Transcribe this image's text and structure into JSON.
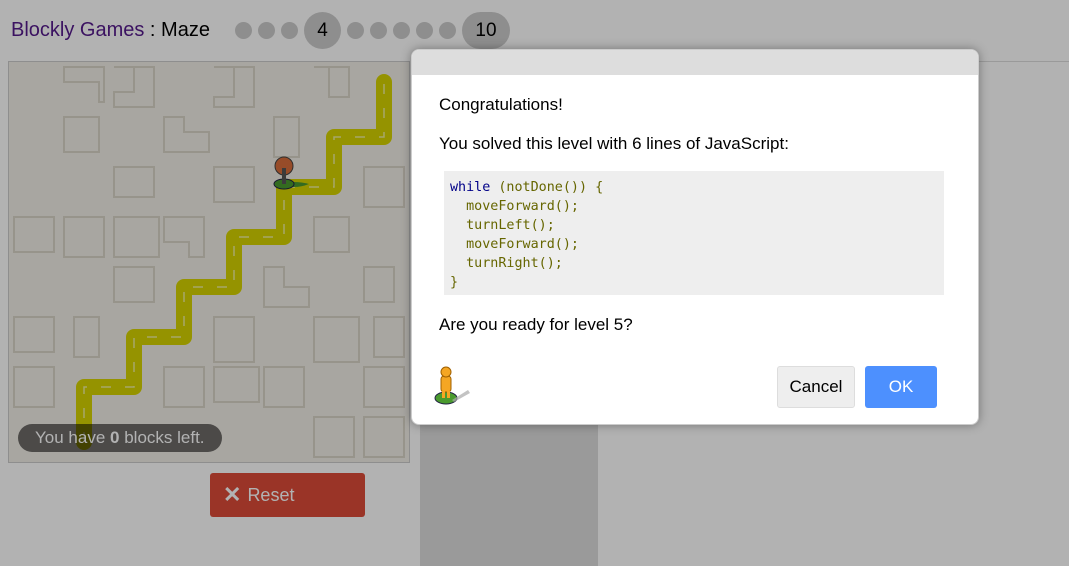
{
  "header": {
    "app_name": "Blockly Games",
    "separator": " : ",
    "game_name": "Maze",
    "current_level": "4",
    "last_level": "10"
  },
  "maze": {
    "capacity_prefix": "You have ",
    "capacity_count": "0",
    "capacity_suffix": " blocks left.",
    "reset_label": "Reset"
  },
  "dialog": {
    "congrats": "Congratulations!",
    "solved": "You solved this level with 6 lines of JavaScript:",
    "code": {
      "keyword": "while",
      "condition": " (notDone()) {",
      "lines": [
        "  moveForward();",
        "  turnLeft();",
        "  moveForward();",
        "  turnRight();"
      ],
      "close": "}"
    },
    "ready": "Are you ready for level 5?",
    "cancel_label": "Cancel",
    "ok_label": "OK"
  },
  "colors": {
    "path": "#d6d300",
    "reset": "#dd4b39",
    "ok": "#4d90fe",
    "link": "#551a8b"
  }
}
